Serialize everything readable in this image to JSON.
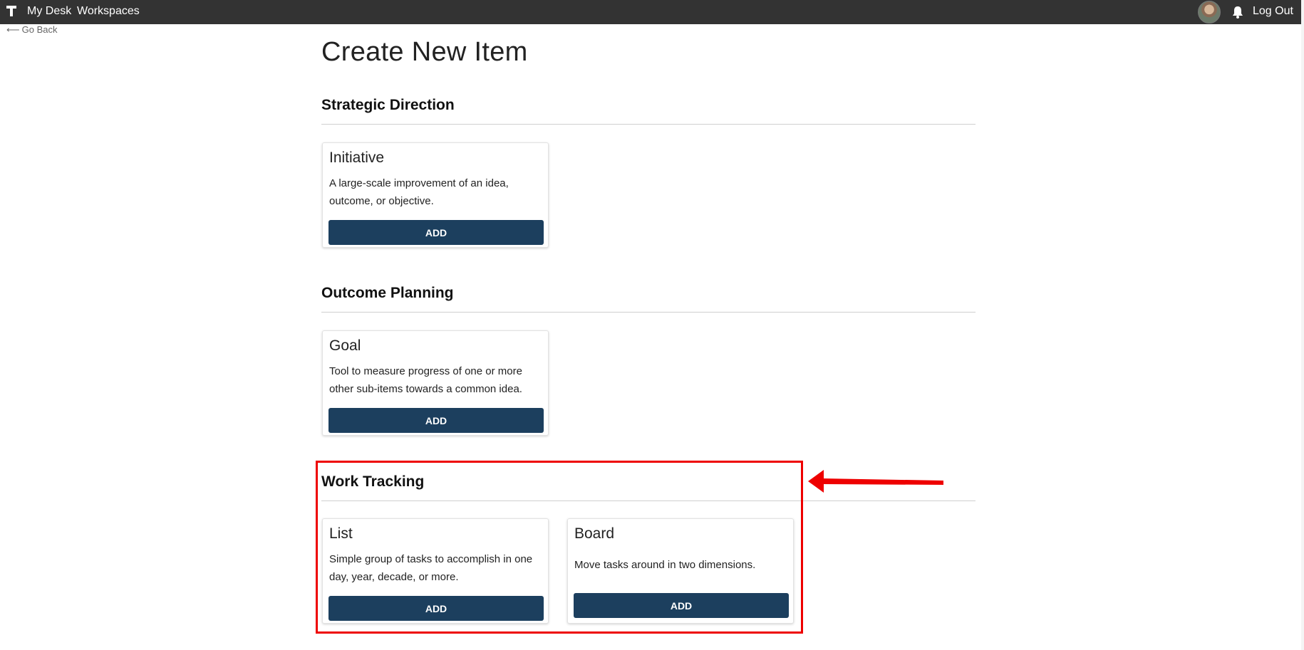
{
  "topbar": {
    "nav": [
      "My Desk",
      "Workspaces"
    ],
    "logout_label": "Log Out"
  },
  "go_back_label": "Go Back",
  "page_title": "Create New Item",
  "sections": [
    {
      "title": "Strategic Direction",
      "cards": [
        {
          "title": "Initiative",
          "description": "A large-scale improvement of an idea, outcome, or objective.",
          "button": "ADD"
        }
      ]
    },
    {
      "title": "Outcome Planning",
      "cards": [
        {
          "title": "Goal",
          "description": "Tool to measure progress of one or more other sub-items towards a common idea.",
          "button": "ADD"
        }
      ]
    },
    {
      "title": "Work Tracking",
      "cards": [
        {
          "title": "List",
          "description": "Simple group of tasks to accomplish in one day, year, decade, or more.",
          "button": "ADD"
        },
        {
          "title": "Board",
          "description": "Move tasks around in two dimensions.",
          "button": "ADD"
        }
      ]
    }
  ],
  "colors": {
    "topbar": "#333333",
    "button": "#1c3f5e",
    "annotation": "#ee0000"
  }
}
